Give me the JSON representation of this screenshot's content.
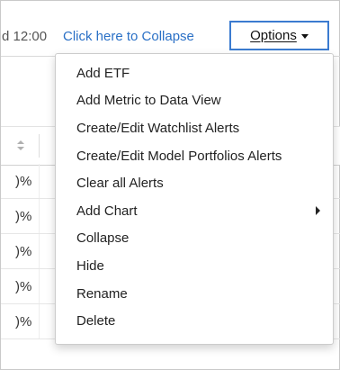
{
  "header": {
    "timestamp": "d 12:00",
    "collapse_link": "Click here to Collapse",
    "options_label": "Options"
  },
  "table": {
    "rows": [
      {
        "value": ")%"
      },
      {
        "value": ")%"
      },
      {
        "value": ")%"
      },
      {
        "value": ")%"
      },
      {
        "value": ")%"
      }
    ],
    "fragment_right": ""
  },
  "menu": {
    "items": [
      {
        "label": "Add ETF",
        "submenu": false
      },
      {
        "label": "Add Metric to Data View",
        "submenu": false
      },
      {
        "label": "Create/Edit Watchlist Alerts",
        "submenu": false
      },
      {
        "label": "Create/Edit Model Portfolios Alerts",
        "submenu": false
      },
      {
        "label": "Clear all Alerts",
        "submenu": false
      },
      {
        "label": "Add Chart",
        "submenu": true
      },
      {
        "label": "Collapse",
        "submenu": false
      },
      {
        "label": "Hide",
        "submenu": false
      },
      {
        "label": "Rename",
        "submenu": false
      },
      {
        "label": "Delete",
        "submenu": false
      }
    ]
  },
  "colors": {
    "link": "#2a70c6",
    "button_border": "#3b7bd0",
    "badge_green": "#2fa84f"
  }
}
